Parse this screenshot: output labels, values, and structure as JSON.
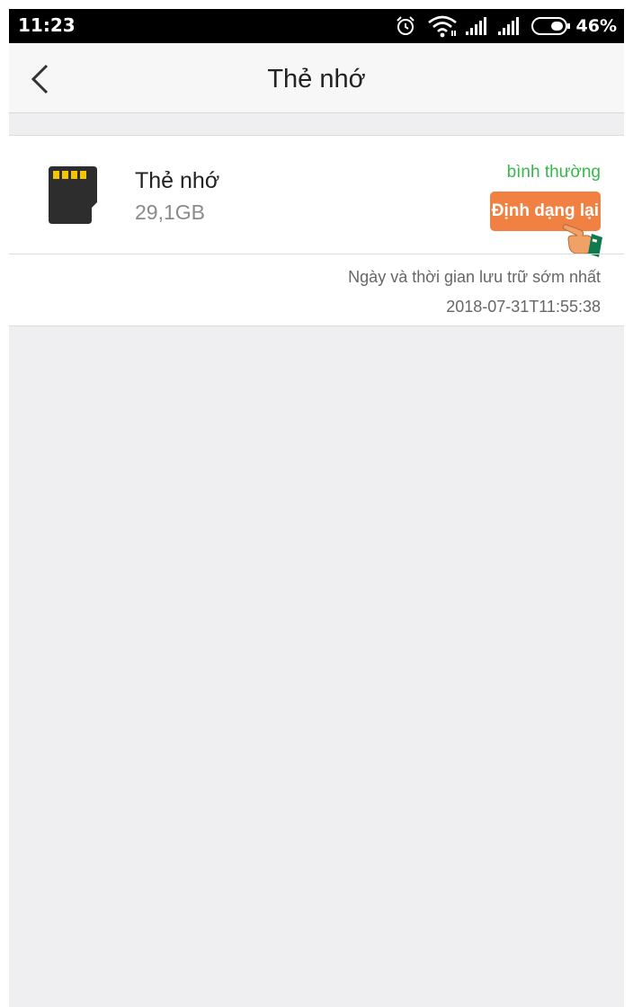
{
  "status_bar": {
    "time": "11:23",
    "battery_percent": "46%",
    "icons": [
      "alarm-icon",
      "wifi-icon",
      "signal-icon",
      "signal-icon",
      "battery-icon"
    ]
  },
  "header": {
    "back_icon": "chevron-left-icon",
    "title": "Thẻ nhớ"
  },
  "card": {
    "icon": "sd-card-icon",
    "name": "Thẻ nhớ",
    "size": "29,1GB",
    "status": "bình thường",
    "format_button": "Định dạng lại",
    "earliest_label": "Ngày và thời gian lưu trữ sớm nhất",
    "earliest_value": "2018-07-31T11:55:38"
  },
  "colors": {
    "status_green": "#36b84a",
    "button_orange": "#f08143",
    "background": "#efeff2"
  }
}
